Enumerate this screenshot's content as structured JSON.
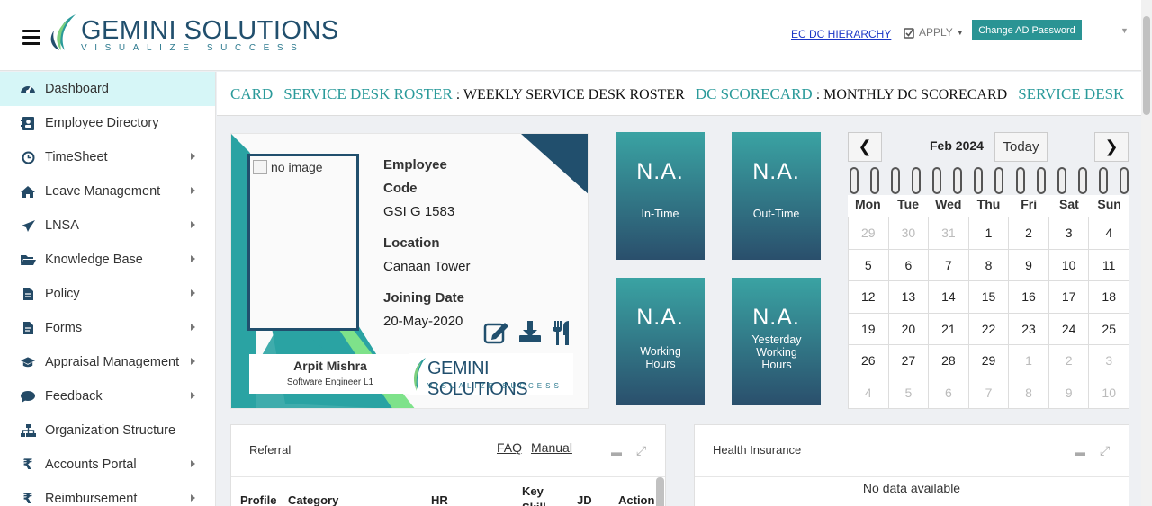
{
  "header": {
    "logo_title": "GEMINI SOLUTIONS",
    "logo_tagline": "VISUALIZE SUCCESS",
    "hierarchy_link": "EC DC HIERARCHY",
    "apply_label": "APPLY",
    "change_password": "Change AD Password"
  },
  "sidebar": {
    "items": [
      {
        "label": "Dashboard",
        "icon": "dashboard-icon"
      },
      {
        "label": "Employee Directory",
        "icon": "directory-icon"
      },
      {
        "label": "TimeSheet",
        "icon": "clock-icon"
      },
      {
        "label": "Leave Management",
        "icon": "home-icon"
      },
      {
        "label": "LNSA",
        "icon": "paper-plane-icon"
      },
      {
        "label": "Knowledge Base",
        "icon": "folder-icon"
      },
      {
        "label": "Policy",
        "icon": "document-icon"
      },
      {
        "label": "Forms",
        "icon": "form-icon"
      },
      {
        "label": "Appraisal Management",
        "icon": "graduation-cap-icon"
      },
      {
        "label": "Feedback",
        "icon": "comment-icon"
      },
      {
        "label": "Organization Structure",
        "icon": "sitemap-icon"
      },
      {
        "label": "Accounts Portal",
        "icon": "rupee-icon"
      },
      {
        "label": "Reimbursement",
        "icon": "rupee-icon"
      }
    ]
  },
  "marquee": {
    "lead": "CARD",
    "items": [
      {
        "title": "SERVICE DESK ROSTER",
        "desc": " : WEEKLY SERVICE DESK ROSTER"
      },
      {
        "title": "DC SCORECARD",
        "desc": " : MONTHLY DC SCORECARD"
      },
      {
        "title": "SERVICE DESK",
        "desc": ""
      }
    ]
  },
  "idcard": {
    "photo_alt": "no image",
    "code_label_1": "Employee",
    "code_label_2": "Code",
    "code_value": "GSI G 1583",
    "location_label": "Location",
    "location_value": "Canaan Tower",
    "joining_label": "Joining Date",
    "joining_value": "20-May-2020",
    "name": "Arpit Mishra",
    "designation": "Software Engineer L1",
    "logo_title": "GEMINI SOLUTIONS",
    "logo_tagline": "VISUALIZE SUCCESS"
  },
  "tiles": [
    {
      "value": "N.A.",
      "label": "In-Time"
    },
    {
      "value": "N.A.",
      "label": "Out-Time"
    },
    {
      "value": "N.A.",
      "label": "Working Hours"
    },
    {
      "value": "N.A.",
      "label": "Yesterday Working Hours"
    }
  ],
  "calendar": {
    "prev": "❮",
    "next": "❯",
    "title": "Feb 2024",
    "today": "Today",
    "weekdays": [
      "Mon",
      "Tue",
      "Wed",
      "Thu",
      "Fri",
      "Sat",
      "Sun"
    ],
    "days": [
      [
        "29",
        "30",
        "31",
        "1",
        "2",
        "3",
        "4"
      ],
      [
        "5",
        "6",
        "7",
        "8",
        "9",
        "10",
        "11"
      ],
      [
        "12",
        "13",
        "14",
        "15",
        "16",
        "17",
        "18"
      ],
      [
        "19",
        "20",
        "21",
        "22",
        "23",
        "24",
        "25"
      ],
      [
        "26",
        "27",
        "28",
        "29",
        "1",
        "2",
        "3"
      ],
      [
        "4",
        "5",
        "6",
        "7",
        "8",
        "9",
        "10"
      ]
    ]
  },
  "referral": {
    "title": "Referral",
    "faq": "FAQ",
    "manual": "Manual",
    "columns": [
      "Profile",
      "Category",
      "HR",
      "Key Skill",
      "JD",
      "Action"
    ]
  },
  "health": {
    "title": "Health Insurance",
    "empty": "No data available"
  }
}
